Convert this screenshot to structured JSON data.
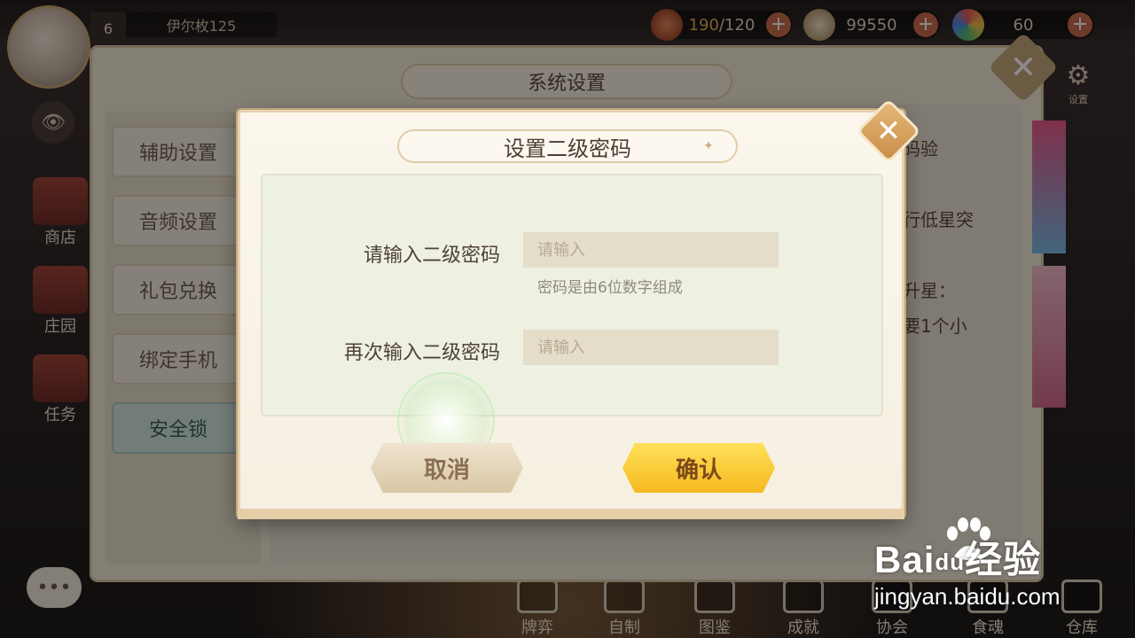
{
  "hud": {
    "level": "6",
    "player_name": "伊尔枚125",
    "stamina_current": "190",
    "stamina_max": "/120",
    "coins": "99550",
    "gems": "60",
    "plus": "+",
    "settings_label": "设置",
    "settings_icon": "gear-icon"
  },
  "side_nav": {
    "shop": "商店",
    "manor": "庄园",
    "tasks": "任务"
  },
  "bottom_nav": [
    "牌弈",
    "自制",
    "图鉴",
    "成就",
    "协会",
    "食魂",
    "仓库"
  ],
  "settings_panel": {
    "title": "系统设置",
    "menu": [
      "辅助设置",
      "音频设置",
      "礼包兑换",
      "绑定手机",
      "安全锁"
    ],
    "active_menu": "安全锁",
    "bg_text": [
      "码验",
      "行低星突",
      "升星：",
      "要1个小"
    ]
  },
  "dialog": {
    "title": "设置二级密码",
    "field1_label": "请输入二级密码",
    "field1_placeholder": "请输入",
    "hint": "密码是由6位数字组成",
    "field2_label": "再次输入二级密码",
    "field2_placeholder": "请输入",
    "cancel": "取消",
    "confirm": "确认",
    "close": "✕"
  },
  "watermark": {
    "logo_a": "Bai",
    "logo_b": "du",
    "logo_c": "经验",
    "url": "jingyan.baidu.com"
  },
  "colors": {
    "confirm_button": "#f6b91f",
    "cancel_button": "#d9c7a4",
    "active_menu": "#cfe4df",
    "close_button": "#c98d48"
  }
}
